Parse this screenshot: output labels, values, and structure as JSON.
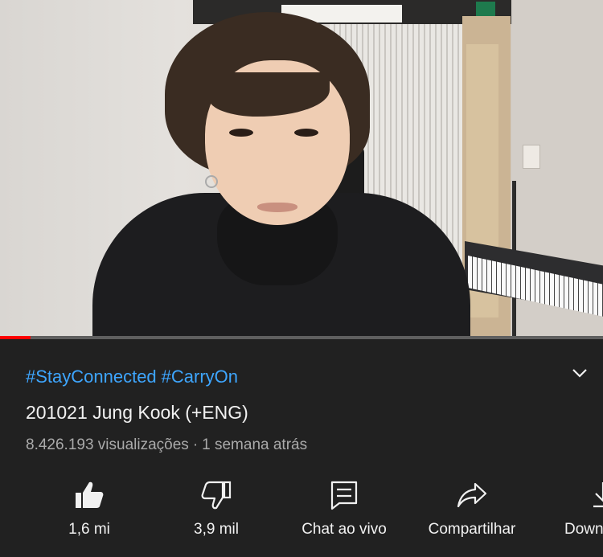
{
  "video": {
    "progress_percent": 5
  },
  "info": {
    "hashtags": [
      "#StayConnected",
      "#CarryOn"
    ],
    "title": "201021 Jung Kook (+ENG)",
    "views": "8.426.193 visualizações",
    "separator": "·",
    "age": "1 semana atrás"
  },
  "actions": {
    "like": {
      "label": "1,6 mi",
      "icon": "thumb-up-icon"
    },
    "dislike": {
      "label": "3,9 mil",
      "icon": "thumb-down-icon"
    },
    "chat": {
      "label": "Chat ao vivo",
      "icon": "chat-icon"
    },
    "share": {
      "label": "Compartilhar",
      "icon": "share-icon"
    },
    "download": {
      "label": "Down",
      "icon": "download-icon"
    }
  },
  "colors": {
    "background": "#212121",
    "hashtag": "#3ea6ff",
    "meta_text": "#aaaaaa",
    "progress": "#ff0000"
  }
}
